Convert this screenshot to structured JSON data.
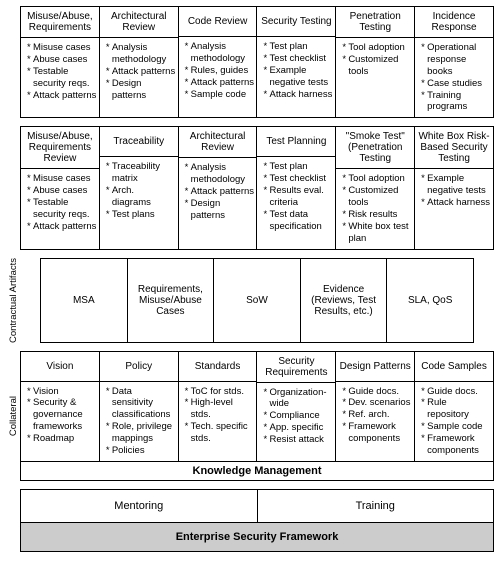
{
  "row1": [
    {
      "h": "Misuse/Abuse, Requirements",
      "items": [
        "Misuse cases",
        "Abuse cases",
        "Testable security reqs.",
        "Attack patterns"
      ]
    },
    {
      "h": "Architectural Review",
      "items": [
        "Analysis methodology",
        "Attack patterns",
        "Design patterns"
      ]
    },
    {
      "h": "Code Review",
      "items": [
        "Analysis methodology",
        "Rules, guides",
        "Attack patterns",
        "Sample code"
      ]
    },
    {
      "h": "Security Testing",
      "items": [
        "Test plan",
        "Test checklist",
        "Example negative tests",
        "Attack harness"
      ]
    },
    {
      "h": "Penetration Testing",
      "items": [
        "Tool adoption",
        "Customized tools"
      ]
    },
    {
      "h": "Incidence Response",
      "items": [
        "Operational response books",
        "Case studies",
        "Training programs"
      ]
    }
  ],
  "row2": [
    {
      "h": "Misuse/Abuse, Requirements Review",
      "items": [
        "Misuse cases",
        "Abuse cases",
        "Testable security reqs.",
        "Attack patterns"
      ]
    },
    {
      "h": "Traceability",
      "items": [
        "Traceability matrix",
        "Arch. diagrams",
        "Test plans"
      ]
    },
    {
      "h": "Architectural Review",
      "items": [
        "Analysis methodology",
        "Attack patterns",
        "Design patterns"
      ]
    },
    {
      "h": "Test Planning",
      "items": [
        "Test plan",
        "Test checklist",
        "Results eval. criteria",
        "Test data specification"
      ]
    },
    {
      "h": "\"Smoke Test\" (Penetration Testing",
      "items": [
        "Tool adoption",
        "Customized tools",
        "Risk results",
        "White box test plan"
      ]
    },
    {
      "h": "White Box Risk-Based Security Testing",
      "items": [
        "Example negative tests",
        "Attack harness"
      ]
    }
  ],
  "contractual": {
    "label": "Contractual Artifacts",
    "cells": [
      "MSA",
      "Requirements, Misuse/Abuse Cases",
      "SoW",
      "Evidence (Reviews, Test Results, etc.)",
      "SLA, QoS"
    ]
  },
  "collateral": {
    "label": "Collateral",
    "cols": [
      {
        "h": "Vision",
        "items": [
          "Vision",
          "Security & governance frameworks",
          "Roadmap"
        ]
      },
      {
        "h": "Policy",
        "items": [
          "Data sensitivity classifications",
          "Role, privilege mappings",
          "Policies"
        ]
      },
      {
        "h": "Standards",
        "items": [
          "ToC for stds.",
          "High-level stds.",
          "Tech. specific stds."
        ]
      },
      {
        "h": "Security Requirements",
        "items": [
          "Organization-wide",
          "Compliance",
          "App. specific",
          "Resist attack"
        ]
      },
      {
        "h": "Design Patterns",
        "items": [
          "Guide docs.",
          "Dev. scenarios",
          "Ref. arch.",
          "Framework components"
        ]
      },
      {
        "h": "Code Samples",
        "items": [
          "Guide docs.",
          "Rule repository",
          "Sample code",
          "Framework components"
        ]
      }
    ],
    "km": "Knowledge Management"
  },
  "mentoring": [
    "Mentoring",
    "Training"
  ],
  "esf": "Enterprise Security Framework"
}
